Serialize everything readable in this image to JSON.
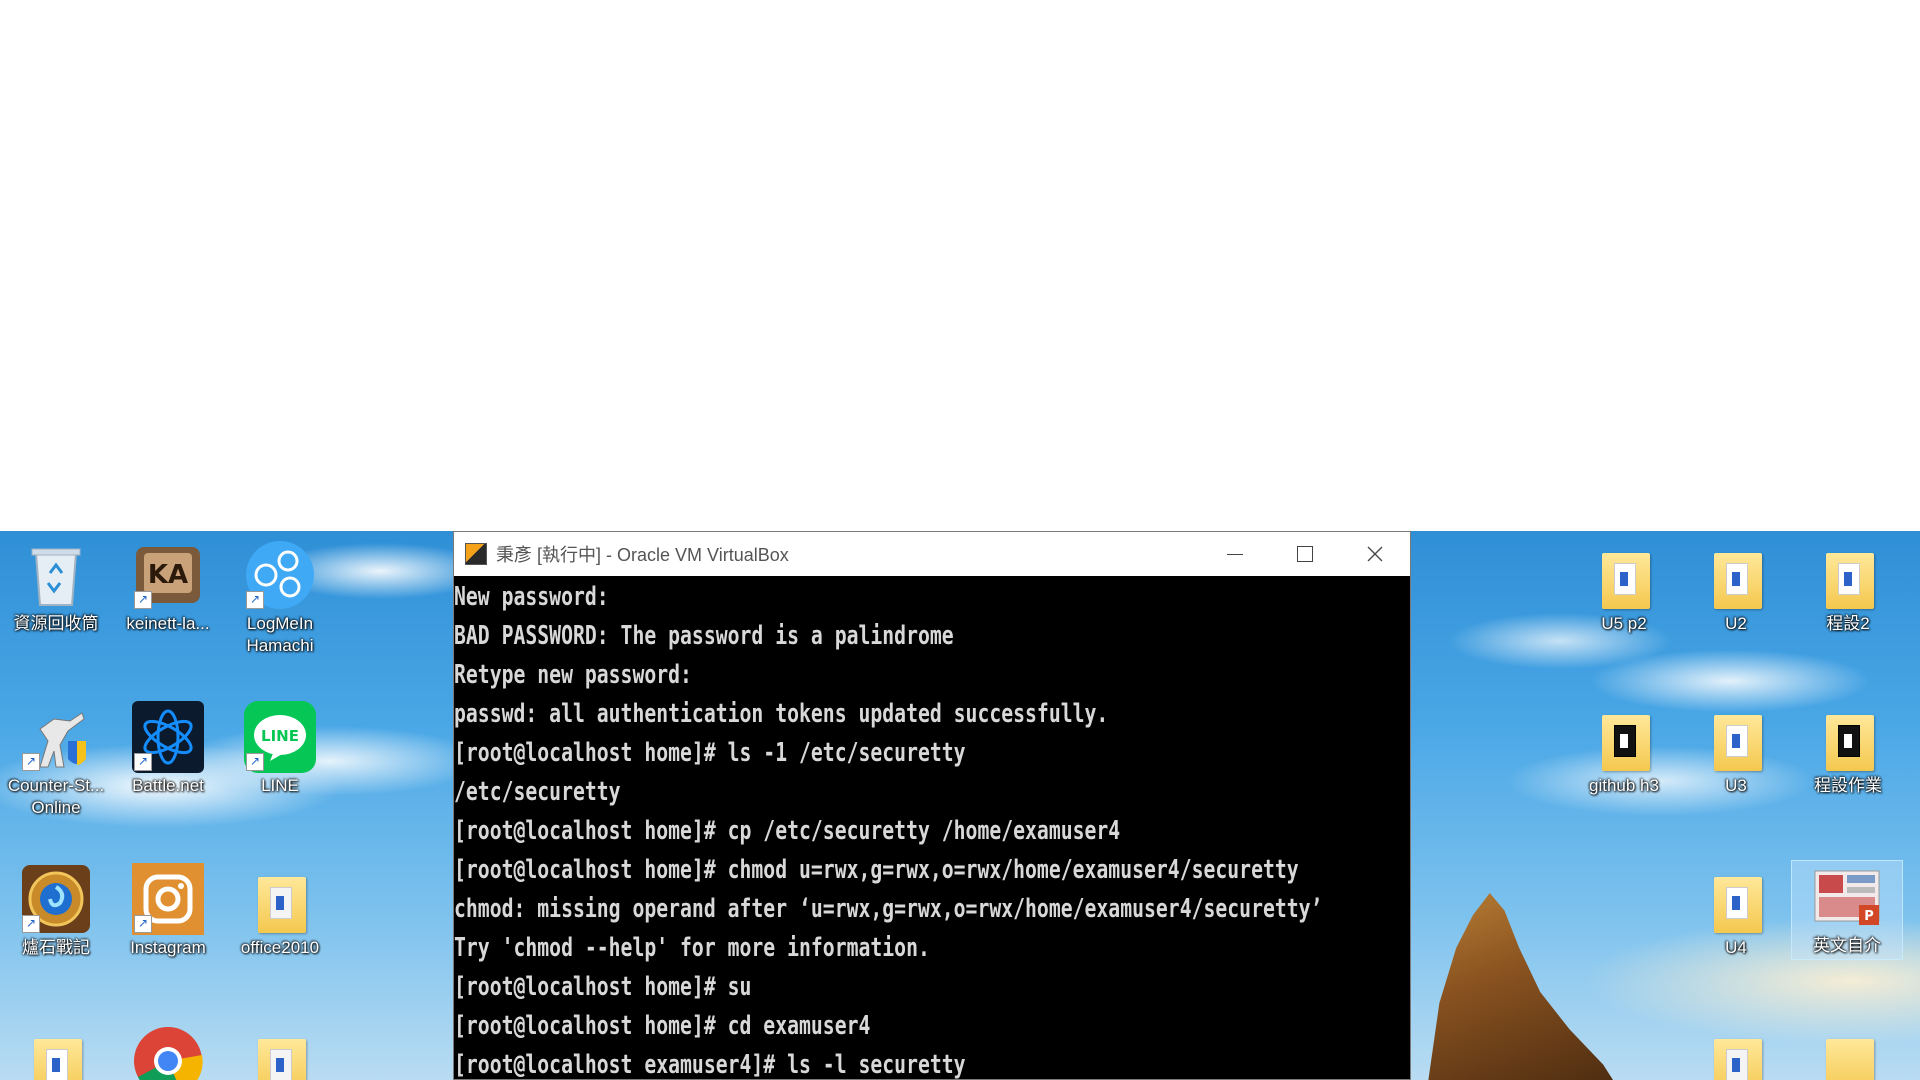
{
  "desktop": {
    "icons_left": [
      {
        "label": "資源回收筒",
        "icon": "recycle-bin-icon"
      },
      {
        "label": "keinett-la...",
        "icon": "keinett-icon"
      },
      {
        "label": "LogMeIn",
        "label2": "Hamachi",
        "icon": "hamachi-icon"
      },
      {
        "label": "Counter-St...",
        "label2": "Online",
        "icon": "counter-strike-icon"
      },
      {
        "label": "Battle.net",
        "icon": "battlenet-icon"
      },
      {
        "label": "LINE",
        "icon": "line-icon",
        "badge": "LINE"
      },
      {
        "label": "爐石戰記",
        "icon": "hearthstone-icon"
      },
      {
        "label": "Instagram",
        "icon": "instagram-icon"
      },
      {
        "label": "office2010",
        "icon": "folder-icon"
      }
    ],
    "icons_right": [
      {
        "label": "U5 p2",
        "icon": "folder-icon"
      },
      {
        "label": "U2",
        "icon": "folder-icon"
      },
      {
        "label": "程設2",
        "icon": "folder-icon"
      },
      {
        "label": "github h3",
        "icon": "folder-icon"
      },
      {
        "label": "U3",
        "icon": "folder-icon"
      },
      {
        "label": "程設作業",
        "icon": "folder-icon"
      },
      {
        "label": "U4",
        "icon": "folder-icon"
      },
      {
        "label": "英文自介",
        "icon": "powerpoint-file-icon"
      }
    ]
  },
  "window": {
    "title": "秉彥 [執行中] - Oracle VM VirtualBox",
    "buttons": {
      "minimize": "minimize-icon",
      "maximize": "maximize-icon",
      "close": "close-icon"
    }
  },
  "terminal": {
    "lines": [
      "New password:",
      "BAD PASSWORD: The password is a palindrome",
      "Retype new password:",
      "passwd: all authentication tokens updated successfully.",
      "[root@localhost home]# ls -1 /etc/securetty",
      "/etc/securetty",
      "[root@localhost home]# cp /etc/securetty /home/examuser4",
      "[root@localhost home]# chmod u=rwx,g=rwx,o=rwx/home/examuser4/securetty",
      "chmod: missing operand after ‘u=rwx,g=rwx,o=rwx/home/examuser4/securetty’",
      "Try 'chmod --help' for more information.",
      "[root@localhost home]# su",
      "[root@localhost home]# cd examuser4",
      "[root@localhost examuser4]# ls -l securetty"
    ]
  },
  "colors": {
    "terminal_bg": "#000000",
    "terminal_fg": "#d8d8d8",
    "titlebar_bg": "#ffffff",
    "line_green": "#06c755"
  }
}
